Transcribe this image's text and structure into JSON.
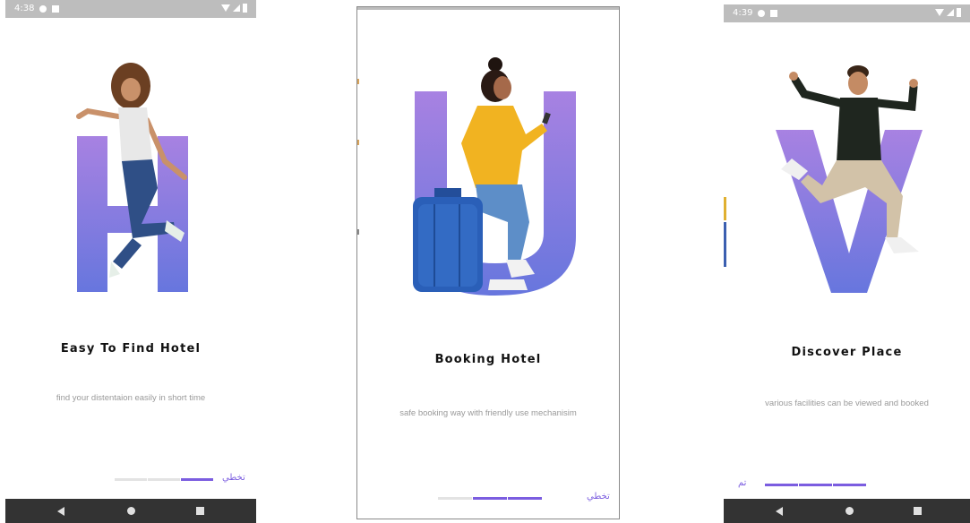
{
  "screens": [
    {
      "id": "screen-1",
      "status": {
        "time": "4:38"
      },
      "letter": "H",
      "title": "Easy To Find Hotel",
      "subtitle": "find your distentaion easily in short time",
      "progress": {
        "total": 3,
        "active": [
          3
        ]
      },
      "action_label": "تخطي",
      "illustration": "woman-jumping"
    },
    {
      "id": "screen-2",
      "letter": "U",
      "title": "Booking Hotel",
      "subtitle": "safe booking way with friendly use mechanisim",
      "progress": {
        "total": 3,
        "active": [
          2,
          3
        ]
      },
      "action_label": "تخطي",
      "illustration": "woman-sitting-on-suitcase"
    },
    {
      "id": "screen-3",
      "status": {
        "time": "4:39"
      },
      "letter": "V",
      "title": "Discover Place",
      "subtitle": "various facilities can be viewed and booked",
      "progress": {
        "total": 3,
        "active": [
          1,
          2,
          3
        ]
      },
      "action_label": "تم",
      "illustration": "man-jumping-thumbs-up"
    }
  ],
  "colors": {
    "accent": "#7b5de0",
    "letter_top": "#a37be0",
    "letter_bottom": "#5f6fdc",
    "statusbar": "#bdbdbd",
    "navbar": "#333333"
  },
  "icons": {
    "back": "nav-back-icon",
    "home": "nav-home-icon",
    "recent": "nav-recent-icon"
  }
}
